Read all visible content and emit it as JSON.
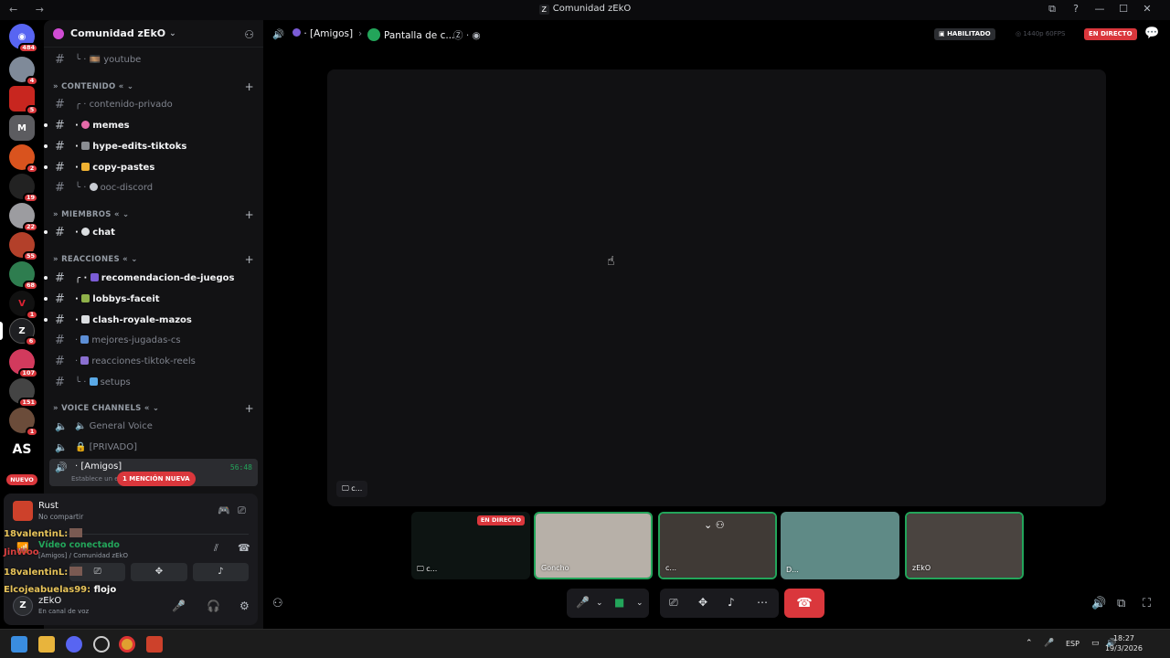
{
  "window": {
    "title": "Comunidad zEkO",
    "nav": "← →",
    "controls": [
      "⧉",
      "?",
      "—",
      "☐",
      "✕"
    ]
  },
  "rail": {
    "badges": [
      "484",
      "4",
      "5",
      "2",
      "19",
      "22",
      "55",
      "68",
      "1",
      "6",
      "107",
      "151",
      "1"
    ],
    "new_label": "NUEVO"
  },
  "sidebar": {
    "server_name": "Comunidad zEkO",
    "caret": "⌄",
    "channels_top": [
      {
        "name": "youtube",
        "prefix": "╰ · 🎞️"
      }
    ],
    "categories": {
      "contenido": "CONTENIDO",
      "miembros": "MIEMBROS",
      "reacciones": "REACCIONES",
      "voice": "VOICE CHANNELS"
    },
    "contenido_channels": [
      "contenido-privado",
      "memes",
      "hype-edits-tiktoks",
      "copy-pastes",
      "ooc-discord"
    ],
    "miembros_channels": [
      "chat"
    ],
    "reacciones_channels": [
      "recomendacion-de-juegos",
      "lobbys-faceit",
      "clash-royale-mazos",
      "mejores-jugadas-cs",
      "reacciones-tiktok-reels",
      "setups"
    ],
    "voice_channels": [
      "General Voice",
      "[PRIVADO]",
      "[Amigos]"
    ],
    "voice_timer": "56:48",
    "voice_sub": "Establece un es",
    "mention": "1 MENCIÓN NUEVA"
  },
  "panel": {
    "activity_title": "Rust",
    "activity_sub": "No compartir",
    "voice_status": "Vídeo conectado",
    "voice_location": "[Amigos] / Comunidad zEkO",
    "username": "zEkO",
    "user_status": "En canal de voz"
  },
  "overlay": {
    "lines": [
      {
        "user": "18valentinL:",
        "msg": "",
        "color": "#e8c45a"
      },
      {
        "user": "JinWoo",
        "msg": "",
        "color": "#d94040"
      },
      {
        "user": "18valentinL:",
        "msg": "",
        "color": "#e8c45a"
      },
      {
        "user": "Elcojeabuelas99:",
        "msg": "flojo",
        "color": "#e8c45a"
      }
    ]
  },
  "topbar": {
    "channel": "[Amigos]",
    "stream": "Pantalla de c...",
    "enabled": "HABILITADO",
    "quality": "1440p 60FPS",
    "live": "EN DIRECTO"
  },
  "stage": {
    "label": "c..."
  },
  "tiles": [
    {
      "name": "c...",
      "live": "EN DIRECTO",
      "color": "#0d1412"
    },
    {
      "name": "Goncho",
      "live": "",
      "color": "#b7b0a8"
    },
    {
      "name": "c...",
      "live": "",
      "color": "#403a36"
    },
    {
      "name": "D...",
      "live": "",
      "color": "#5f8a86"
    },
    {
      "name": "zEkO",
      "live": "",
      "color": "#4a4440"
    }
  ],
  "taskbar": {
    "lang": "ESP",
    "time": "18:27",
    "date": "19/3/2026"
  }
}
